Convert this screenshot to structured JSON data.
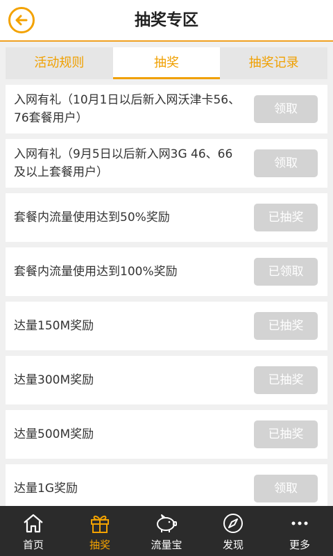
{
  "header": {
    "title": "抽奖专区",
    "back_icon": "back-arrow-icon",
    "accent": "#f3a200"
  },
  "tabs": [
    {
      "label": "活动规则",
      "active": false
    },
    {
      "label": "抽奖",
      "active": true
    },
    {
      "label": "抽奖记录",
      "active": false
    }
  ],
  "items": [
    {
      "text": "入网有礼（10月1日以后新入网沃津卡56、76套餐用户）",
      "button": "领取"
    },
    {
      "text": "入网有礼（9月5日以后新入网3G 46、66及以上套餐用户）",
      "button": "领取"
    },
    {
      "text": "套餐内流量使用达到50%奖励",
      "button": "已抽奖"
    },
    {
      "text": "套餐内流量使用达到100%奖励",
      "button": "已领取"
    },
    {
      "text": "达量150M奖励",
      "button": "已抽奖"
    },
    {
      "text": "达量300M奖励",
      "button": "已抽奖"
    },
    {
      "text": "达量500M奖励",
      "button": "已抽奖"
    },
    {
      "text": "达量1G奖励",
      "button": "领取"
    }
  ],
  "nav": [
    {
      "label": "首页",
      "icon": "home-icon",
      "active": false
    },
    {
      "label": "抽奖",
      "icon": "gift-icon",
      "active": true
    },
    {
      "label": "流量宝",
      "icon": "piggy-bank-icon",
      "active": false
    },
    {
      "label": "发现",
      "icon": "compass-icon",
      "active": false
    },
    {
      "label": "更多",
      "icon": "more-dots-icon",
      "active": false
    }
  ]
}
